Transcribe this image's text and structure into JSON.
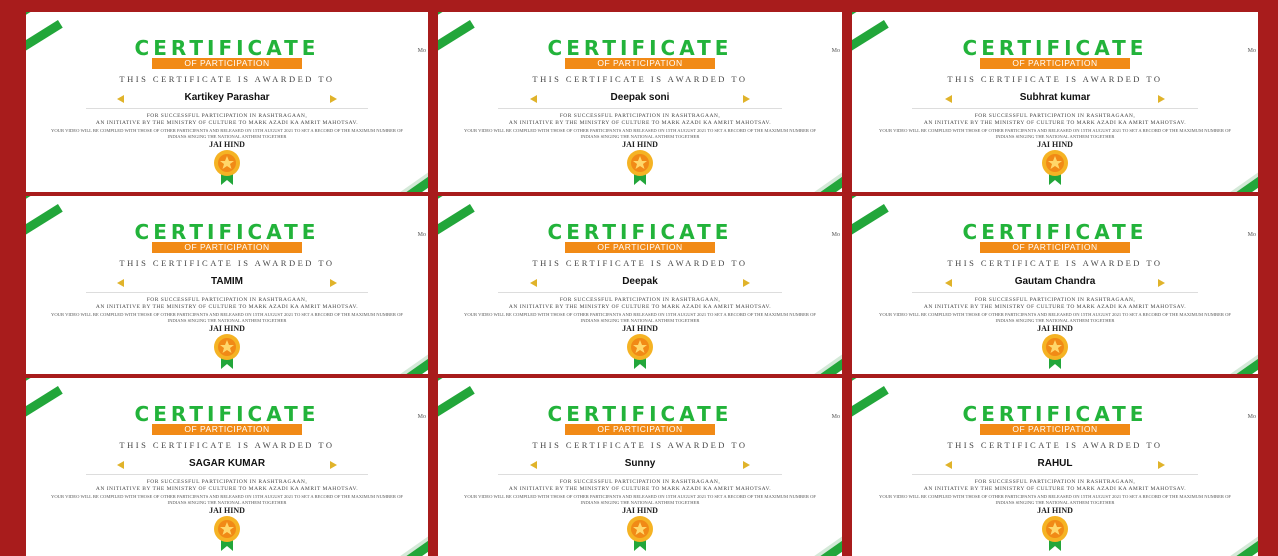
{
  "certificate": {
    "title": "CERTIFICATE",
    "ribbon": "OF PARTICIPATION",
    "awarded": "THIS CERTIFICATE IS AWARDED TO",
    "line1": "FOR SUCCESSFUL PARTICIPATION IN RASHTRAGAAN,",
    "line2": "AN INITIATIVE BY THE MINISTRY OF CULTURE TO MARK AZADI KA AMRIT MAHOTSAV.",
    "line3": "YOUR VIDEO WILL BE COMPILED WITH THOSE OF OTHER PARTICIPANTS AND RELEASED ON 15TH AUGUST 2021 TO SET A RECORD OF THE MAXIMUM NUMBER OF INDIANS SINGING THE NATIONAL ANTHEM TOGETHER",
    "jai_hind": "JAI HIND",
    "side_text": "Mo",
    "colors": {
      "green": "#22b33a",
      "orange": "#f18a16",
      "gold": "#e0b32a",
      "border": "#a81c1c"
    }
  },
  "recipients": [
    "Kartikey Parashar",
    "Deepak soni",
    "Subhrat kumar",
    "TAMIM",
    "Deepak",
    "Gautam Chandra",
    "SAGAR KUMAR",
    "Sunny",
    "RAHUL"
  ]
}
